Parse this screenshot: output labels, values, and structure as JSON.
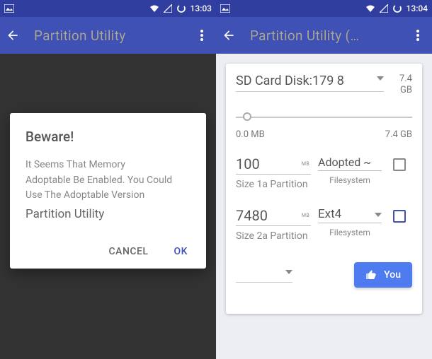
{
  "status": {
    "time_left": "13:03",
    "time_right": "13:04"
  },
  "header": {
    "title_left": "Partition Utility",
    "title_right": "Partition Utility (…"
  },
  "dialog": {
    "title": "Beware!",
    "line1": "It Seems That Memory",
    "line2": "Adoptable Be Enabled. You Could",
    "line3": "Use The Adoptable Version",
    "line4": "Partition Utility",
    "cancel": "CANCEL",
    "ok": "OK"
  },
  "disk": {
    "label": "SD Card Disk:179  8",
    "size_top": "7.4",
    "size_bottom": "GB"
  },
  "slider": {
    "min": "0.0 MB",
    "max": "7.4 GB"
  },
  "part1": {
    "size": "100",
    "unit": "MB",
    "fs": "Adopted ~",
    "size_label": "Size 1a Partition",
    "fs_label": "Filesystem"
  },
  "part2": {
    "size": "7480",
    "unit": "MB",
    "fs": "Ext4",
    "size_label": "Size 2a Partition",
    "fs_label": "Filesystem"
  },
  "go_button": {
    "label": "You"
  }
}
